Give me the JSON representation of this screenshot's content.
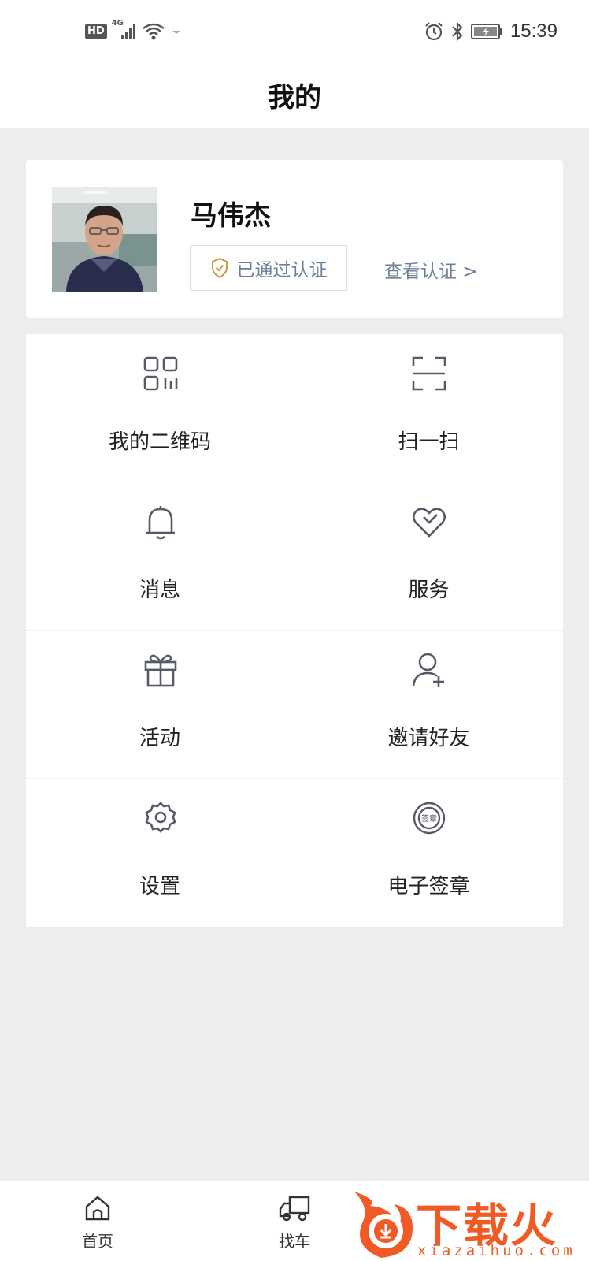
{
  "status_bar": {
    "hd": "HD",
    "network": "4G",
    "time": "15:39"
  },
  "header": {
    "title": "我的"
  },
  "profile": {
    "name": "马伟杰",
    "verified_label": "已通过认证",
    "view_cert_label": "查看认证 >"
  },
  "menu": {
    "items": [
      {
        "label": "我的二维码",
        "icon": "qr-code-icon"
      },
      {
        "label": "扫一扫",
        "icon": "scan-icon"
      },
      {
        "label": "消息",
        "icon": "bell-icon"
      },
      {
        "label": "服务",
        "icon": "heart-icon"
      },
      {
        "label": "活动",
        "icon": "gift-icon"
      },
      {
        "label": "邀请好友",
        "icon": "add-user-icon"
      },
      {
        "label": "设置",
        "icon": "gear-icon"
      },
      {
        "label": "电子签章",
        "icon": "stamp-icon"
      }
    ]
  },
  "stamp_text": "签章",
  "bottom_nav": {
    "items": [
      {
        "label": "首页",
        "icon": "home-icon"
      },
      {
        "label": "找车",
        "icon": "truck-icon"
      }
    ]
  },
  "watermark": {
    "text": "下载火",
    "sub": "xiazaihuo.com"
  },
  "colors": {
    "accent_gold": "#c99a3b",
    "link_blue_gray": "#6e7f98",
    "watermark_orange": "#f15a24",
    "background": "#ededed"
  }
}
